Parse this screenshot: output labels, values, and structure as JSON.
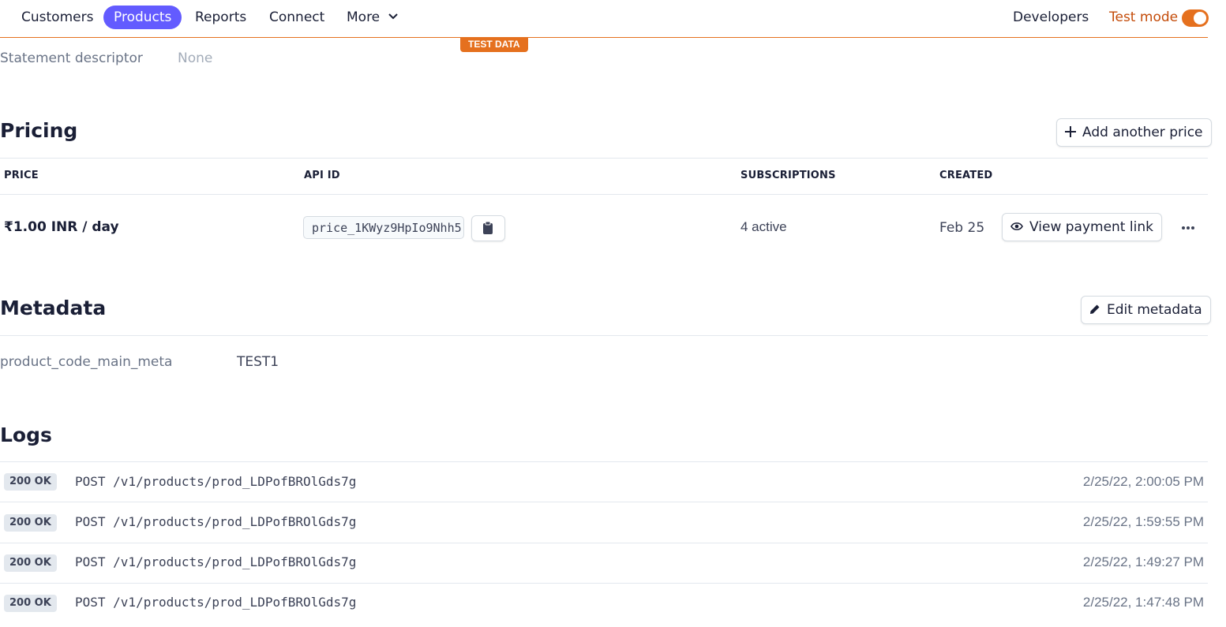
{
  "nav": {
    "items": [
      {
        "label": "Customers"
      },
      {
        "label": "Products",
        "active": true
      },
      {
        "label": "Reports"
      },
      {
        "label": "Connect"
      },
      {
        "label": "More"
      }
    ],
    "developers": "Developers",
    "test_mode": "Test mode",
    "test_mode_on": true
  },
  "test_data_badge": "TEST DATA",
  "statement": {
    "label": "Statement descriptor",
    "value": "None"
  },
  "pricing": {
    "title": "Pricing",
    "add_button": "Add another price",
    "headers": {
      "price": "PRICE",
      "api_id": "API ID",
      "subscriptions": "SUBSCRIPTIONS",
      "created": "CREATED"
    },
    "row": {
      "price": "₹1.00 INR / day",
      "api_id": "price_1KWyz9HpIo9Nhh5",
      "subscriptions": "4 active",
      "created": "Feb 25",
      "link_button": "View payment link"
    }
  },
  "metadata": {
    "title": "Metadata",
    "edit_button": "Edit metadata",
    "key": "product_code_main_meta",
    "value": "TEST1"
  },
  "logs": {
    "title": "Logs",
    "entries": [
      {
        "status": "200 OK",
        "request": "POST /v1/products/prod_LDPofBROlGds7g",
        "time": "2/25/22, 2:00:05 PM"
      },
      {
        "status": "200 OK",
        "request": "POST /v1/products/prod_LDPofBROlGds7g",
        "time": "2/25/22, 1:59:55 PM"
      },
      {
        "status": "200 OK",
        "request": "POST /v1/products/prod_LDPofBROlGds7g",
        "time": "2/25/22, 1:49:27 PM"
      },
      {
        "status": "200 OK",
        "request": "POST /v1/products/prod_LDPofBROlGds7g",
        "time": "2/25/22, 1:47:48 PM"
      }
    ]
  },
  "colors": {
    "accent": "#635bff",
    "test_mode": "#e5701e"
  }
}
